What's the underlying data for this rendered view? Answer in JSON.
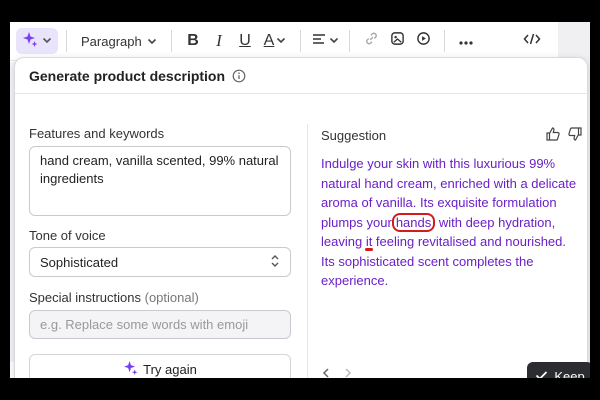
{
  "toolbar": {
    "paragraph_label": "Paragraph"
  },
  "panel": {
    "title": "Generate product description",
    "features": {
      "label": "Features and keywords",
      "value": "hand cream, vanilla scented, 99% natural ingredients"
    },
    "tone": {
      "label": "Tone of voice",
      "value": "Sophisticated"
    },
    "instructions": {
      "label": "Special instructions",
      "optional": "(optional)",
      "placeholder": "e.g. Replace some words with emoji"
    },
    "try_again_label": "Try again",
    "suggestion": {
      "label": "Suggestion",
      "text_part1": "Indulge your skin with this luxurious 99% natural hand cream, enriched with a delicate aroma of vanilla. Its exquisite formulation plumps your",
      "text_circled": "hands",
      "text_part2": " with deep hydration, leaving ",
      "text_marked": "it",
      "text_part3": " feeling revitalised and nourished. Its sophisticated scent completes the experience."
    },
    "keep_label": "Keep"
  },
  "colors": {
    "accent_purple": "#6a1fc7",
    "annotation_red": "#d21c1c",
    "keep_button_bg": "#2b2d31"
  },
  "icons": [
    "ai-sparkle-icon",
    "chevron-down-icon",
    "bold-icon",
    "italic-icon",
    "underline-icon",
    "text-color-icon",
    "align-icon",
    "link-icon",
    "image-icon",
    "media-icon",
    "more-icon",
    "source-code-icon",
    "info-icon",
    "unfold-icon",
    "sparkle-icon",
    "thumbs-up-icon",
    "thumbs-down-icon",
    "chevron-left-icon",
    "chevron-right-icon",
    "check-icon"
  ]
}
